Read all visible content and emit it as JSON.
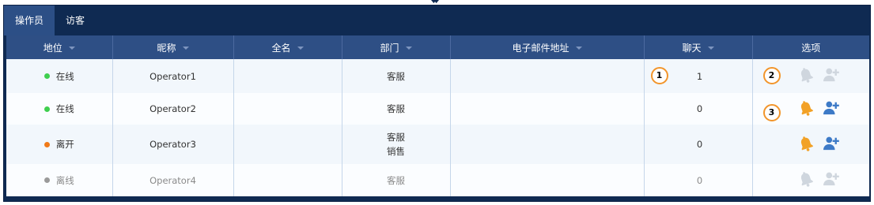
{
  "tabs": [
    {
      "label": "操作员",
      "active": true
    },
    {
      "label": "访客",
      "active": false
    }
  ],
  "columns": [
    "地位",
    "昵称",
    "全名",
    "部门",
    "电子邮件地址",
    "聊天",
    "选项"
  ],
  "rows": [
    {
      "status": "在线",
      "status_color": "#3fcf4f",
      "nickname": "Operator1",
      "full_name": "",
      "departments": [
        "客服"
      ],
      "email": "",
      "chats": "1",
      "bell": "muted",
      "add_user": "muted",
      "chat_badge": "1",
      "option_badge": "2"
    },
    {
      "status": "在线",
      "status_color": "#3fcf4f",
      "nickname": "Operator2",
      "full_name": "",
      "departments": [
        "客服"
      ],
      "email": "",
      "chats": "0",
      "bell": "active",
      "add_user": "active",
      "option_badge": "3"
    },
    {
      "status": "离开",
      "status_color": "#f07a18",
      "nickname": "Operator3",
      "full_name": "",
      "departments": [
        "客服",
        "销售"
      ],
      "email": "",
      "chats": "0",
      "bell": "active",
      "add_user": "active"
    },
    {
      "status": "离线",
      "status_color": "#9a9a9a",
      "nickname": "Operator4",
      "full_name": "",
      "departments": [
        "客服"
      ],
      "email": "",
      "chats": "0",
      "bell": "muted",
      "add_user": "muted"
    }
  ],
  "colors": {
    "header_bg": "#0f2a52",
    "column_header_bg": "#2e4f85",
    "bell_active": "#f2a126",
    "user_active": "#3d7ac7",
    "icon_muted": "#cfd6de",
    "badge_border": "#f2952b"
  },
  "icons": {
    "bell": "bell-icon",
    "add_user": "add-user-icon",
    "sort": "sort-caret-icon"
  }
}
